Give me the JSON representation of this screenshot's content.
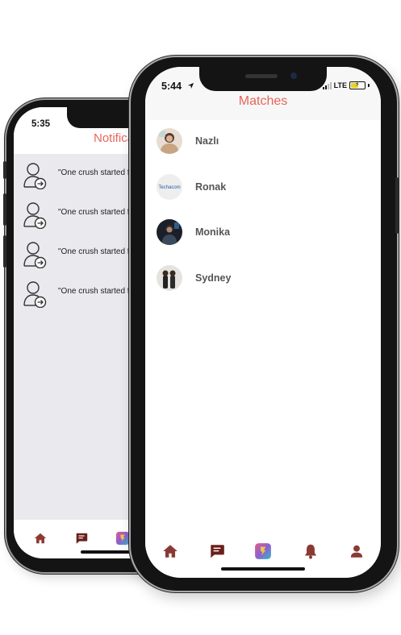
{
  "back_phone": {
    "status_time": "5:35",
    "title": "Notifications",
    "notifications": [
      {
        "text": "\"One crush started following you\""
      },
      {
        "text": "\"One crush started following you\""
      },
      {
        "text": "\"One crush started following you\""
      },
      {
        "text": "\"One crush started following you\""
      }
    ],
    "tabs": [
      "home-icon",
      "chat-icon",
      "app-logo-icon"
    ]
  },
  "front_phone": {
    "status_time": "5:44",
    "network": "LTE",
    "title": "Matches",
    "matches": [
      {
        "name": "Nazlı"
      },
      {
        "name": "Ronak",
        "avatar_text": "Techacom"
      },
      {
        "name": "Monika"
      },
      {
        "name": "Sydney"
      }
    ],
    "tabs": [
      "home-icon",
      "chat-icon",
      "app-logo-icon",
      "bell-icon",
      "profile-icon"
    ]
  },
  "colors": {
    "accent": "#e8655b",
    "tab_icon": "#8b3a33",
    "tab_active": "#6b1f1a",
    "notification_bg": "#e9e9ee"
  }
}
